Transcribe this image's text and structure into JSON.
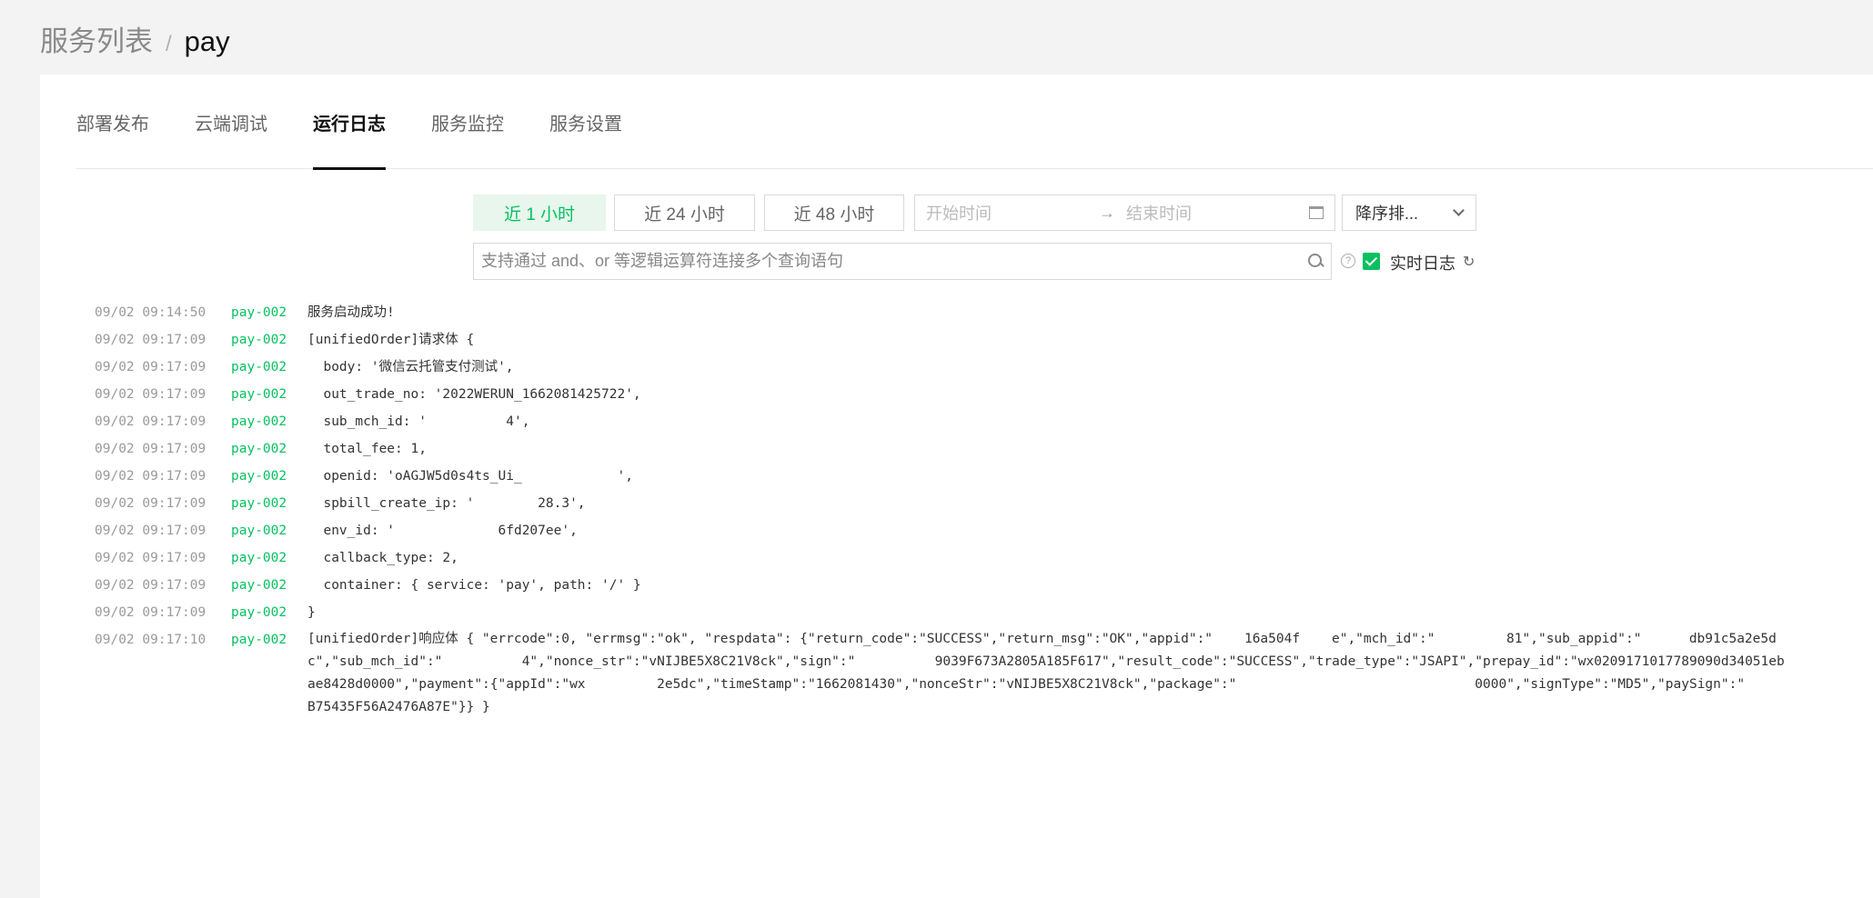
{
  "breadcrumb": {
    "parent": "服务列表",
    "separator": "/",
    "current": "pay"
  },
  "tabs": [
    {
      "label": "部署发布"
    },
    {
      "label": "云端调试"
    },
    {
      "label": "运行日志"
    },
    {
      "label": "服务监控"
    },
    {
      "label": "服务设置"
    }
  ],
  "active_tab": "运行日志",
  "filters": {
    "range_1h": "近 1 小时",
    "range_24h": "近 24 小时",
    "range_48h": "近 48 小时",
    "start_placeholder": "开始时间",
    "arrow": "→",
    "end_placeholder": "结束时间",
    "sort_label": "降序排...",
    "search_placeholder": "支持通过 and、or 等逻辑运算符连接多个查询语句",
    "help": "?",
    "realtime_label": "实时日志",
    "refresh": "↻"
  },
  "colors": {
    "accent": "#07c160",
    "active_bg": "#e8f6ee"
  },
  "logs": [
    {
      "time": "09/02 09:14:50",
      "service": "pay-002",
      "message": "服务启动成功!"
    },
    {
      "time": "09/02 09:17:09",
      "service": "pay-002",
      "message": "[unifiedOrder]请求体 {"
    },
    {
      "time": "09/02 09:17:09",
      "service": "pay-002",
      "message": "  body: '微信云托管支付测试',"
    },
    {
      "time": "09/02 09:17:09",
      "service": "pay-002",
      "message": "  out_trade_no: '2022WERUN_1662081425722',"
    },
    {
      "time": "09/02 09:17:09",
      "service": "pay-002",
      "message": "  sub_mch_id: '          4',"
    },
    {
      "time": "09/02 09:17:09",
      "service": "pay-002",
      "message": "  total_fee: 1,"
    },
    {
      "time": "09/02 09:17:09",
      "service": "pay-002",
      "message": "  openid: 'oAGJW5d0s4ts_Ui_            ',"
    },
    {
      "time": "09/02 09:17:09",
      "service": "pay-002",
      "message": "  spbill_create_ip: '        28.3',"
    },
    {
      "time": "09/02 09:17:09",
      "service": "pay-002",
      "message": "  env_id: '             6fd207ee',"
    },
    {
      "time": "09/02 09:17:09",
      "service": "pay-002",
      "message": "  callback_type: 2,"
    },
    {
      "time": "09/02 09:17:09",
      "service": "pay-002",
      "message": "  container: { service: 'pay', path: '/' }"
    },
    {
      "time": "09/02 09:17:09",
      "service": "pay-002",
      "message": "}"
    },
    {
      "time": "09/02 09:17:10",
      "service": "pay-002",
      "message": "[unifiedOrder]响应体 { \"errcode\":0, \"errmsg\":\"ok\", \"respdata\": {\"return_code\":\"SUCCESS\",\"return_msg\":\"OK\",\"appid\":\"    16a504f    e\",\"mch_id\":\"         81\",\"sub_appid\":\"      db91c5a2e5dc\",\"sub_mch_id\":\"          4\",\"nonce_str\":\"vNIJBE5X8C21V8ck\",\"sign\":\"          9039F673A2805A185F617\",\"result_code\":\"SUCCESS\",\"trade_type\":\"JSAPI\",\"prepay_id\":\"wx0209171017789090d34051ebae8428d0000\",\"payment\":{\"appId\":\"wx         2e5dc\",\"timeStamp\":\"1662081430\",\"nonceStr\":\"vNIJBE5X8C21V8ck\",\"package\":\"                              0000\",\"signType\":\"MD5\",\"paySign\":\"          B75435F56A2476A87E\"}} }"
    }
  ]
}
